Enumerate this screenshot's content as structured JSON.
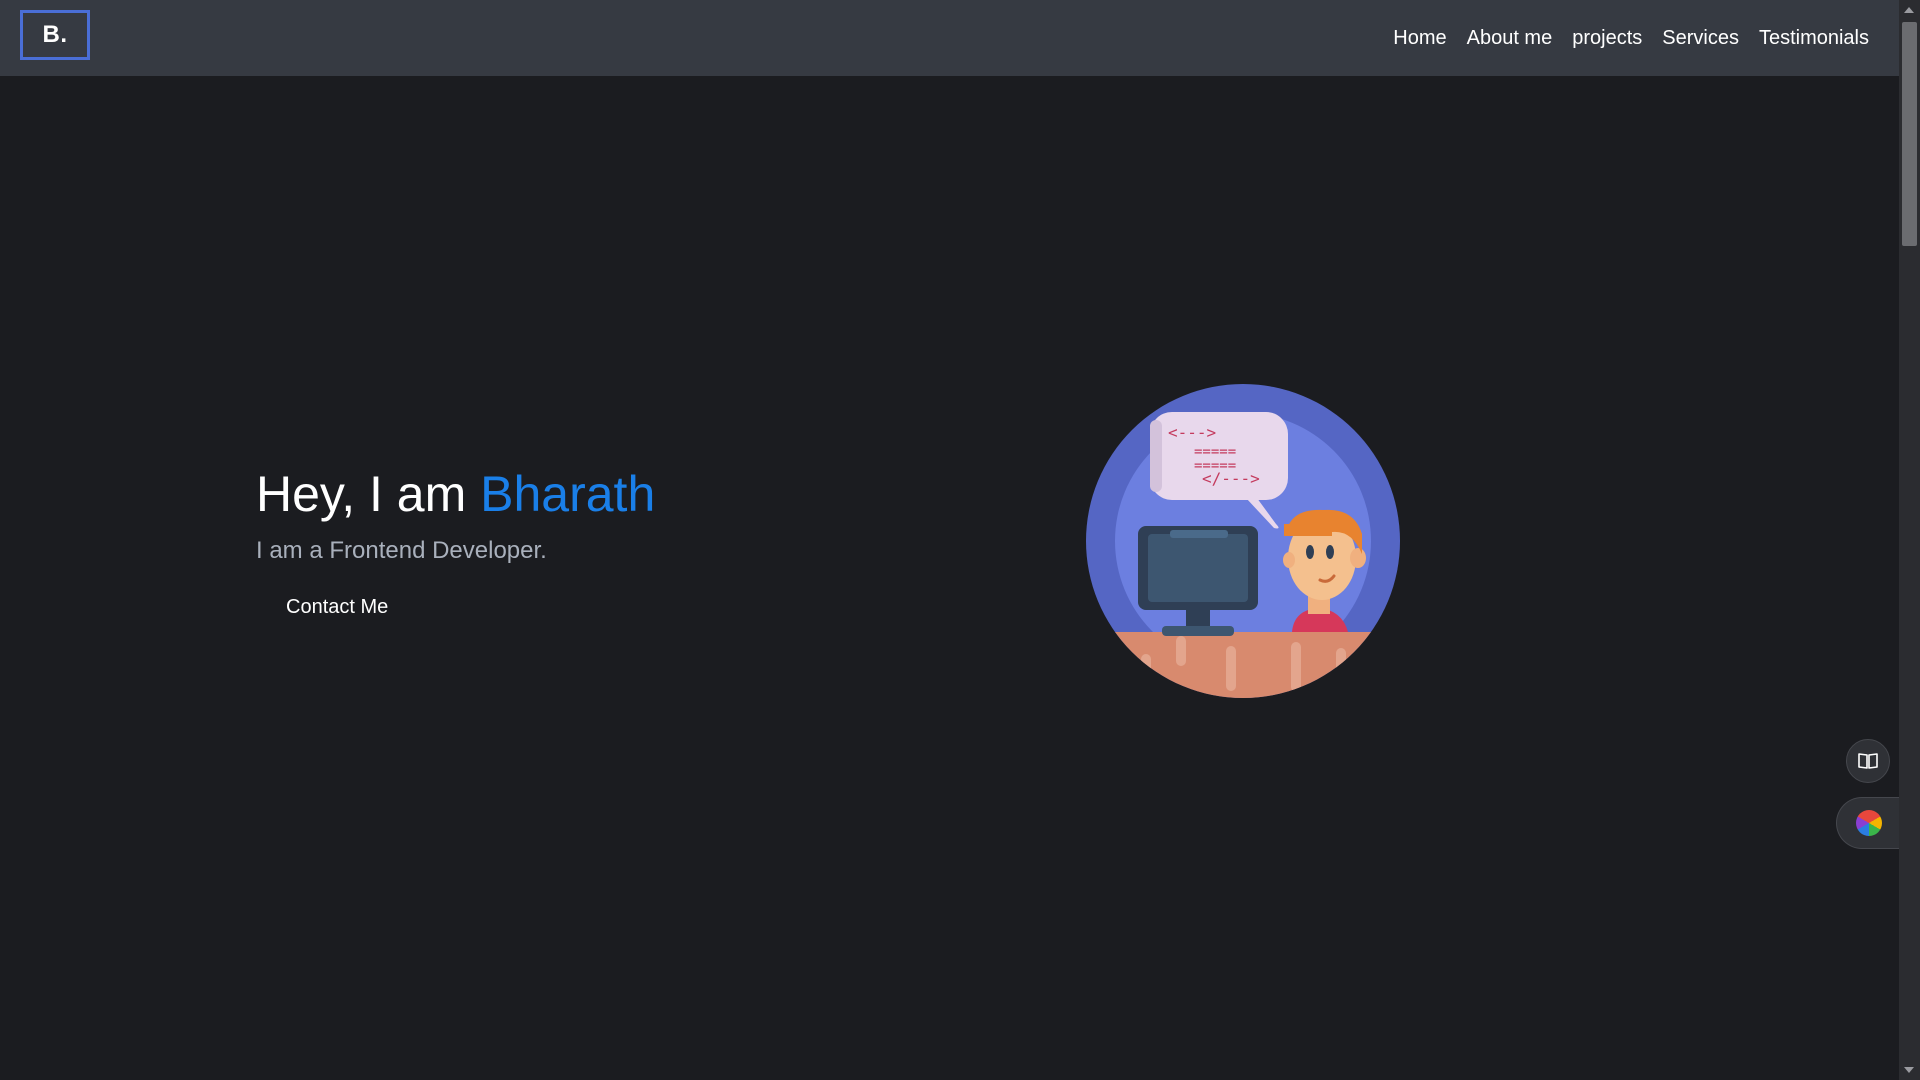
{
  "navbar": {
    "logo": "B.",
    "links": [
      "Home",
      "About me",
      "projects",
      "Services",
      "Testimonials"
    ]
  },
  "hero": {
    "greeting": "Hey, I am ",
    "name": "Bharath",
    "subtitle": "I am a Frontend Developer.",
    "cta": "Contact Me"
  },
  "illustration": {
    "code_lines": [
      "<--->",
      "=====",
      "=====",
      "</--->"
    ]
  },
  "side_tools": {
    "reader_icon": "book-icon",
    "color_icon": "color-palette-icon"
  },
  "colors": {
    "background": "#1b1c20",
    "navbar": "#363a42",
    "accent": "#1a7fe8",
    "logo_border": "#4a6ed6",
    "subtitle": "#a9b0bc"
  }
}
